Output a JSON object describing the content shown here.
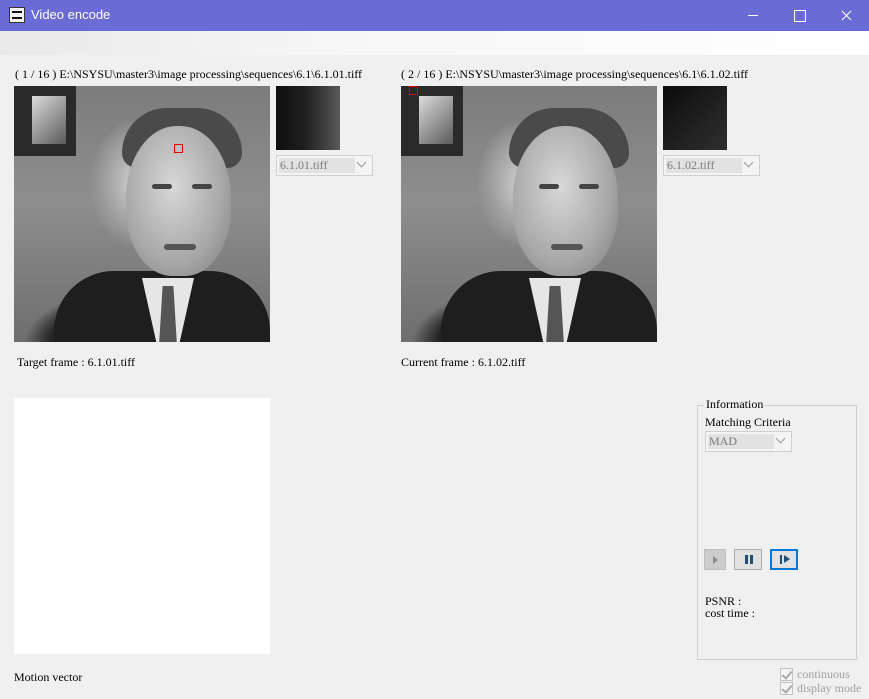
{
  "window": {
    "title": "Video encode"
  },
  "target": {
    "path_label": "( 1 / 16 ) E:\\NSYSU\\master3\\image processing\\sequences\\6.1\\6.1.01.tiff",
    "file_select_value": "6.1.01.tiff",
    "frame_label": "Target frame : 6.1.01.tiff"
  },
  "current": {
    "path_label": "( 2 / 16 ) E:\\NSYSU\\master3\\image processing\\sequences\\6.1\\6.1.02.tiff",
    "file_select_value": "6.1.02.tiff",
    "frame_label": "Current frame : 6.1.02.tiff"
  },
  "motion_vector": {
    "label": "Motion vector"
  },
  "information": {
    "group_title": "Information",
    "criteria_label": "Matching Criteria",
    "criteria_value": "MAD",
    "psnr_label": "PSNR :",
    "cost_time_label": "cost time :"
  },
  "options": {
    "continuous_label": "continuous",
    "display_mode_label": "display mode"
  },
  "icons": [
    "app-icon",
    "minimize-icon",
    "maximize-icon",
    "close-icon",
    "play-icon",
    "pause-icon",
    "step-forward-icon",
    "checkmark-icon"
  ],
  "colors": {
    "titlebar": "#6b6bd6",
    "marker": "#e00000",
    "focus_border": "#0078d7"
  }
}
